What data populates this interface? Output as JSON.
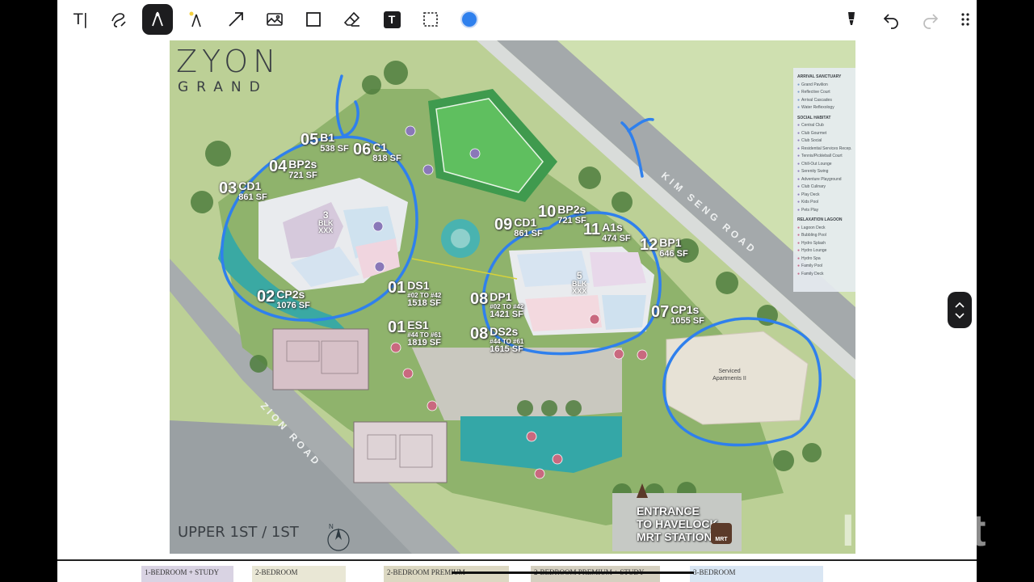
{
  "toolbar": {
    "tools": [
      {
        "name": "text-tool",
        "label": "T|"
      },
      {
        "name": "lasso-tool"
      },
      {
        "name": "pen-tool",
        "active": true
      },
      {
        "name": "highlighter-tool"
      },
      {
        "name": "arrow-tool"
      },
      {
        "name": "image-tool"
      },
      {
        "name": "shape-tool"
      },
      {
        "name": "eraser-tool"
      },
      {
        "name": "textbox-tool",
        "label": "T"
      },
      {
        "name": "selection-tool"
      },
      {
        "name": "color-picker",
        "color": "#2f80ed"
      },
      {
        "name": "marker-tool"
      },
      {
        "name": "undo"
      },
      {
        "name": "redo"
      },
      {
        "name": "more-menu"
      }
    ]
  },
  "plan": {
    "brand_line1": "ZYON",
    "brand_line2": "GRAND",
    "level": "UPPER 1ST / 1ST",
    "units": [
      {
        "num": "05",
        "type": "B1",
        "sf": "538 SF"
      },
      {
        "num": "06",
        "type": "C1",
        "sf": "818 SF"
      },
      {
        "num": "04",
        "type": "BP2s",
        "sf": "721 SF"
      },
      {
        "num": "03",
        "type": "CD1",
        "sf": "861 SF"
      },
      {
        "num": "02",
        "type": "CP2s",
        "sf": "1076 SF"
      },
      {
        "num": "01",
        "type": "DS1",
        "range": "#02 TO #42",
        "sf": "1518 SF"
      },
      {
        "num": "01",
        "type": "ES1",
        "range": "#44 TO #61",
        "sf": "1819 SF"
      },
      {
        "num": "09",
        "type": "CD1",
        "sf": "861 SF"
      },
      {
        "num": "10",
        "type": "BP2s",
        "sf": "721 SF"
      },
      {
        "num": "11",
        "type": "A1s",
        "sf": "474 SF"
      },
      {
        "num": "12",
        "type": "BP1",
        "sf": "646 SF"
      },
      {
        "num": "08",
        "type": "DP1",
        "range": "#02 TO #42",
        "sf": "1421 SF"
      },
      {
        "num": "08",
        "type": "DS2s",
        "range": "#44 TO #61",
        "sf": "1615 SF"
      },
      {
        "num": "07",
        "type": "CP1s",
        "sf": "1055 SF"
      }
    ],
    "blocks": [
      {
        "num": "3",
        "label": "BLK",
        "floors": "XXX"
      },
      {
        "num": "5",
        "label": "BLK",
        "floors": "XXX"
      }
    ],
    "roads": {
      "kim_seng": "KIM SENG ROAD",
      "zion": "ZION ROAD"
    },
    "serviced_apartments": "Serviced Apartments II",
    "entrance_lines": [
      "ENTRANCE",
      "TO HAVELOCK",
      "MRT STATION"
    ],
    "mrt_badge": "MRT",
    "compass": "N",
    "legend": {
      "arrival": {
        "head": "ARRIVAL SANCTUARY",
        "items": [
          "Grand Pavilion",
          "Reflective Court",
          "Arrival Cascades",
          "Water Reflexology"
        ]
      },
      "social": {
        "head": "SOCIAL HABITAT",
        "items": [
          "Central Club",
          "Club Gourmet",
          "Club Social",
          "Residential Services Recep.",
          "Tennis/Pickleball Court",
          "Chill-Out Lounge",
          "Serenity Swing",
          "Adventure Playground",
          "Club Culinary",
          "Play Deck",
          "Kids Pool",
          "Pets Play"
        ]
      },
      "relax": {
        "head": "RELAXATION LAGOON",
        "items": [
          "Lagoon Deck",
          "Bubbling Pool",
          "Hydro Splash",
          "Hydro Lounge",
          "Hydro Spa",
          "Family Pool",
          "Family Deck"
        ]
      }
    }
  },
  "bottom_cards": [
    "1-BEDROOM + STUDY",
    "2-BEDROOM",
    "2-BEDROOM PREMIUM",
    "2-BEDROOM PREMIUM + STUDY",
    "3-BEDROOM"
  ],
  "watermark": "InShOt",
  "colors": {
    "ink": "#1d1d1f",
    "annotation": "#2f80ed",
    "pool": "#3fb0a8",
    "lawn": "#9cc57a"
  }
}
